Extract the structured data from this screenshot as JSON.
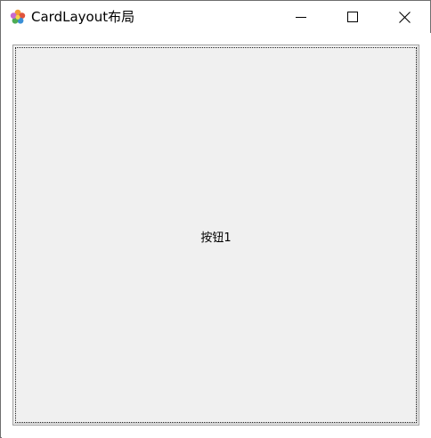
{
  "window": {
    "title": "CardLayout布局",
    "app_icon": "java-flower-icon",
    "controls": {
      "minimize": "minimize-icon",
      "maximize": "maximize-icon",
      "close": "close-icon"
    }
  },
  "card": {
    "button_label": "按钮1"
  },
  "colors": {
    "titlebar_bg": "#ffffff",
    "button_face": "#f0f0f0",
    "border": "#a0a0a0",
    "text": "#000000"
  }
}
